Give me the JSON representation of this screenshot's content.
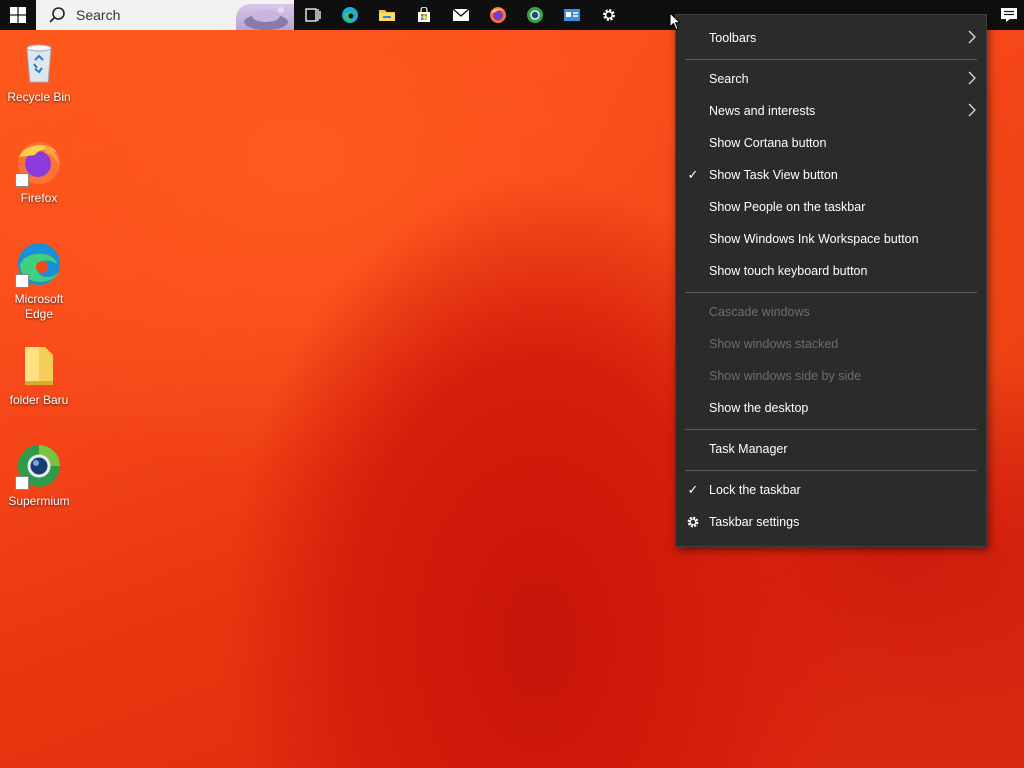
{
  "taskbar": {
    "search_label": "Search",
    "pinned": [
      "task-view",
      "edge",
      "file-explorer",
      "microsoft-store",
      "mail",
      "firefox",
      "supermium",
      "app",
      "settings"
    ]
  },
  "desktop": {
    "icons": [
      {
        "label": "Recycle Bin"
      },
      {
        "label": "Firefox"
      },
      {
        "label": "Microsoft Edge"
      },
      {
        "label": "folder Baru"
      },
      {
        "label": "Supermium"
      }
    ]
  },
  "context_menu": {
    "toolbars": "Toolbars",
    "search": "Search",
    "news": "News and interests",
    "cortana": "Show Cortana button",
    "task_view": "Show Task View button",
    "people": "Show People on the taskbar",
    "ink": "Show Windows Ink Workspace button",
    "touch_kb": "Show touch keyboard button",
    "cascade": "Cascade windows",
    "stacked": "Show windows stacked",
    "side_by_side": "Show windows side by side",
    "show_desktop": "Show the desktop",
    "task_manager": "Task Manager",
    "lock": "Lock the taskbar",
    "settings": "Taskbar settings",
    "checkmark": "✓"
  },
  "colors": {
    "taskbar_bg": "#0f0f10",
    "menu_bg": "#2b2b2b",
    "menu_disabled_text": "#6d6d6d",
    "desktop_orange": "#f7481a",
    "desktop_red": "#d51f0c"
  }
}
